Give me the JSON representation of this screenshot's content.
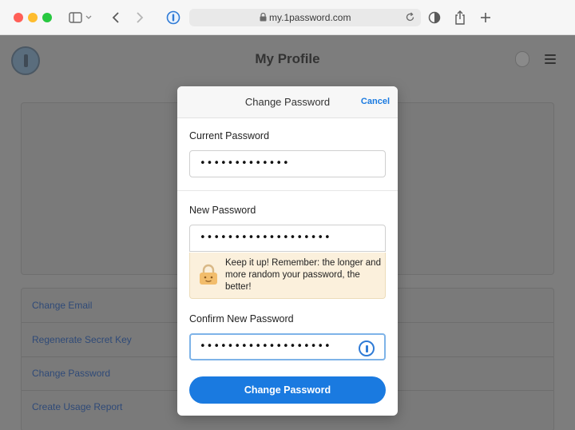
{
  "browser": {
    "url": "my.1password.com",
    "icons": {
      "sidebar": "sidebar-icon",
      "back": "chevron-left-icon",
      "forward": "chevron-right-icon",
      "extension": "1password-extension-icon",
      "lock": "lock-icon",
      "reload": "reload-icon",
      "shield": "shield-icon",
      "share": "share-icon",
      "new_tab": "plus-icon"
    }
  },
  "page": {
    "title": "My Profile",
    "menu_items": [
      "Change Email",
      "Regenerate Secret Key",
      "Change Password",
      "Create Usage Report"
    ]
  },
  "modal": {
    "title": "Change Password",
    "cancel_label": "Cancel",
    "current_password": {
      "label": "Current Password",
      "value": "•••••••••••••"
    },
    "new_password": {
      "label": "New Password",
      "value": "•••••••••••••••••••"
    },
    "hint": "Keep it up! Remember: the longer and more random your password, the better!",
    "confirm_password": {
      "label": "Confirm New Password",
      "value": "•••••••••••••••••••"
    },
    "submit_label": "Change Password"
  },
  "colors": {
    "accent": "#1a7ae0",
    "hint_background": "#fbf0dc",
    "overlay": "#7d7d7d"
  }
}
